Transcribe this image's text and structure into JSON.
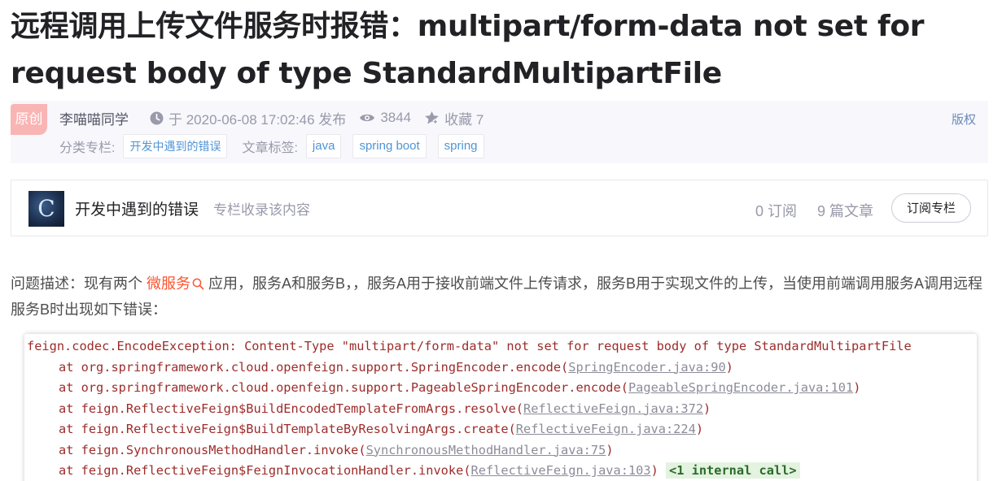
{
  "article": {
    "title": "远程调用上传文件服务时报错：multipart/form-data not set for request body of type StandardMultipartFile"
  },
  "meta": {
    "badge": "原创",
    "author": "李喵喵同学",
    "published": "于 2020-06-08 17:02:46 发布",
    "views": "3844",
    "favorites": "收藏 7",
    "copyright": "版权",
    "category_label": "分类专栏:",
    "category": "开发中遇到的错误",
    "tags_label": "文章标签:",
    "tags": [
      "java",
      "spring boot",
      "spring"
    ]
  },
  "column": {
    "avatar_letter": "C",
    "name": "开发中遇到的错误",
    "desc": "专栏收录该内容",
    "subscribers": "0 订阅",
    "articles": "9 篇文章",
    "subscribe_button": "订阅专栏"
  },
  "content": {
    "para_prefix": "问题描述：现有两个 ",
    "para_keyword": "微服务",
    "para_rest": " 应用，服务A和服务B，，服务A用于接收前端文件上传请求，服务B用于实现文件的上传，当使用前端调用服务A调用远程服务B时出现如下错误："
  },
  "code": {
    "exception": "feign.codec.EncodeException: Content-Type \"multipart/form-data\" not set for request body of type StandardMultipartFile",
    "frames": [
      {
        "method": "at org.springframework.cloud.openfeign.support.SpringEncoder.encode(",
        "source": "SpringEncoder.java:90",
        "suffix": ")",
        "extra": ""
      },
      {
        "method": "at org.springframework.cloud.openfeign.support.PageableSpringEncoder.encode(",
        "source": "PageableSpringEncoder.java:101",
        "suffix": ")",
        "extra": ""
      },
      {
        "method": "at feign.ReflectiveFeign$BuildEncodedTemplateFromArgs.resolve(",
        "source": "ReflectiveFeign.java:372",
        "suffix": ")",
        "extra": ""
      },
      {
        "method": "at feign.ReflectiveFeign$BuildTemplateByResolvingArgs.create(",
        "source": "ReflectiveFeign.java:224",
        "suffix": ")",
        "extra": ""
      },
      {
        "method": "at feign.SynchronousMethodHandler.invoke(",
        "source": "SynchronousMethodHandler.java:75",
        "suffix": ")",
        "extra": ""
      },
      {
        "method": "at feign.ReflectiveFeign$FeignInvocationHandler.invoke(",
        "source": "ReflectiveFeign.java:103",
        "suffix": ") ",
        "extra": "<1 internal call>"
      }
    ]
  },
  "icons": {
    "clock": "clock-icon",
    "views": "eye-icon",
    "favorite": "star-icon",
    "search": "search-icon"
  }
}
